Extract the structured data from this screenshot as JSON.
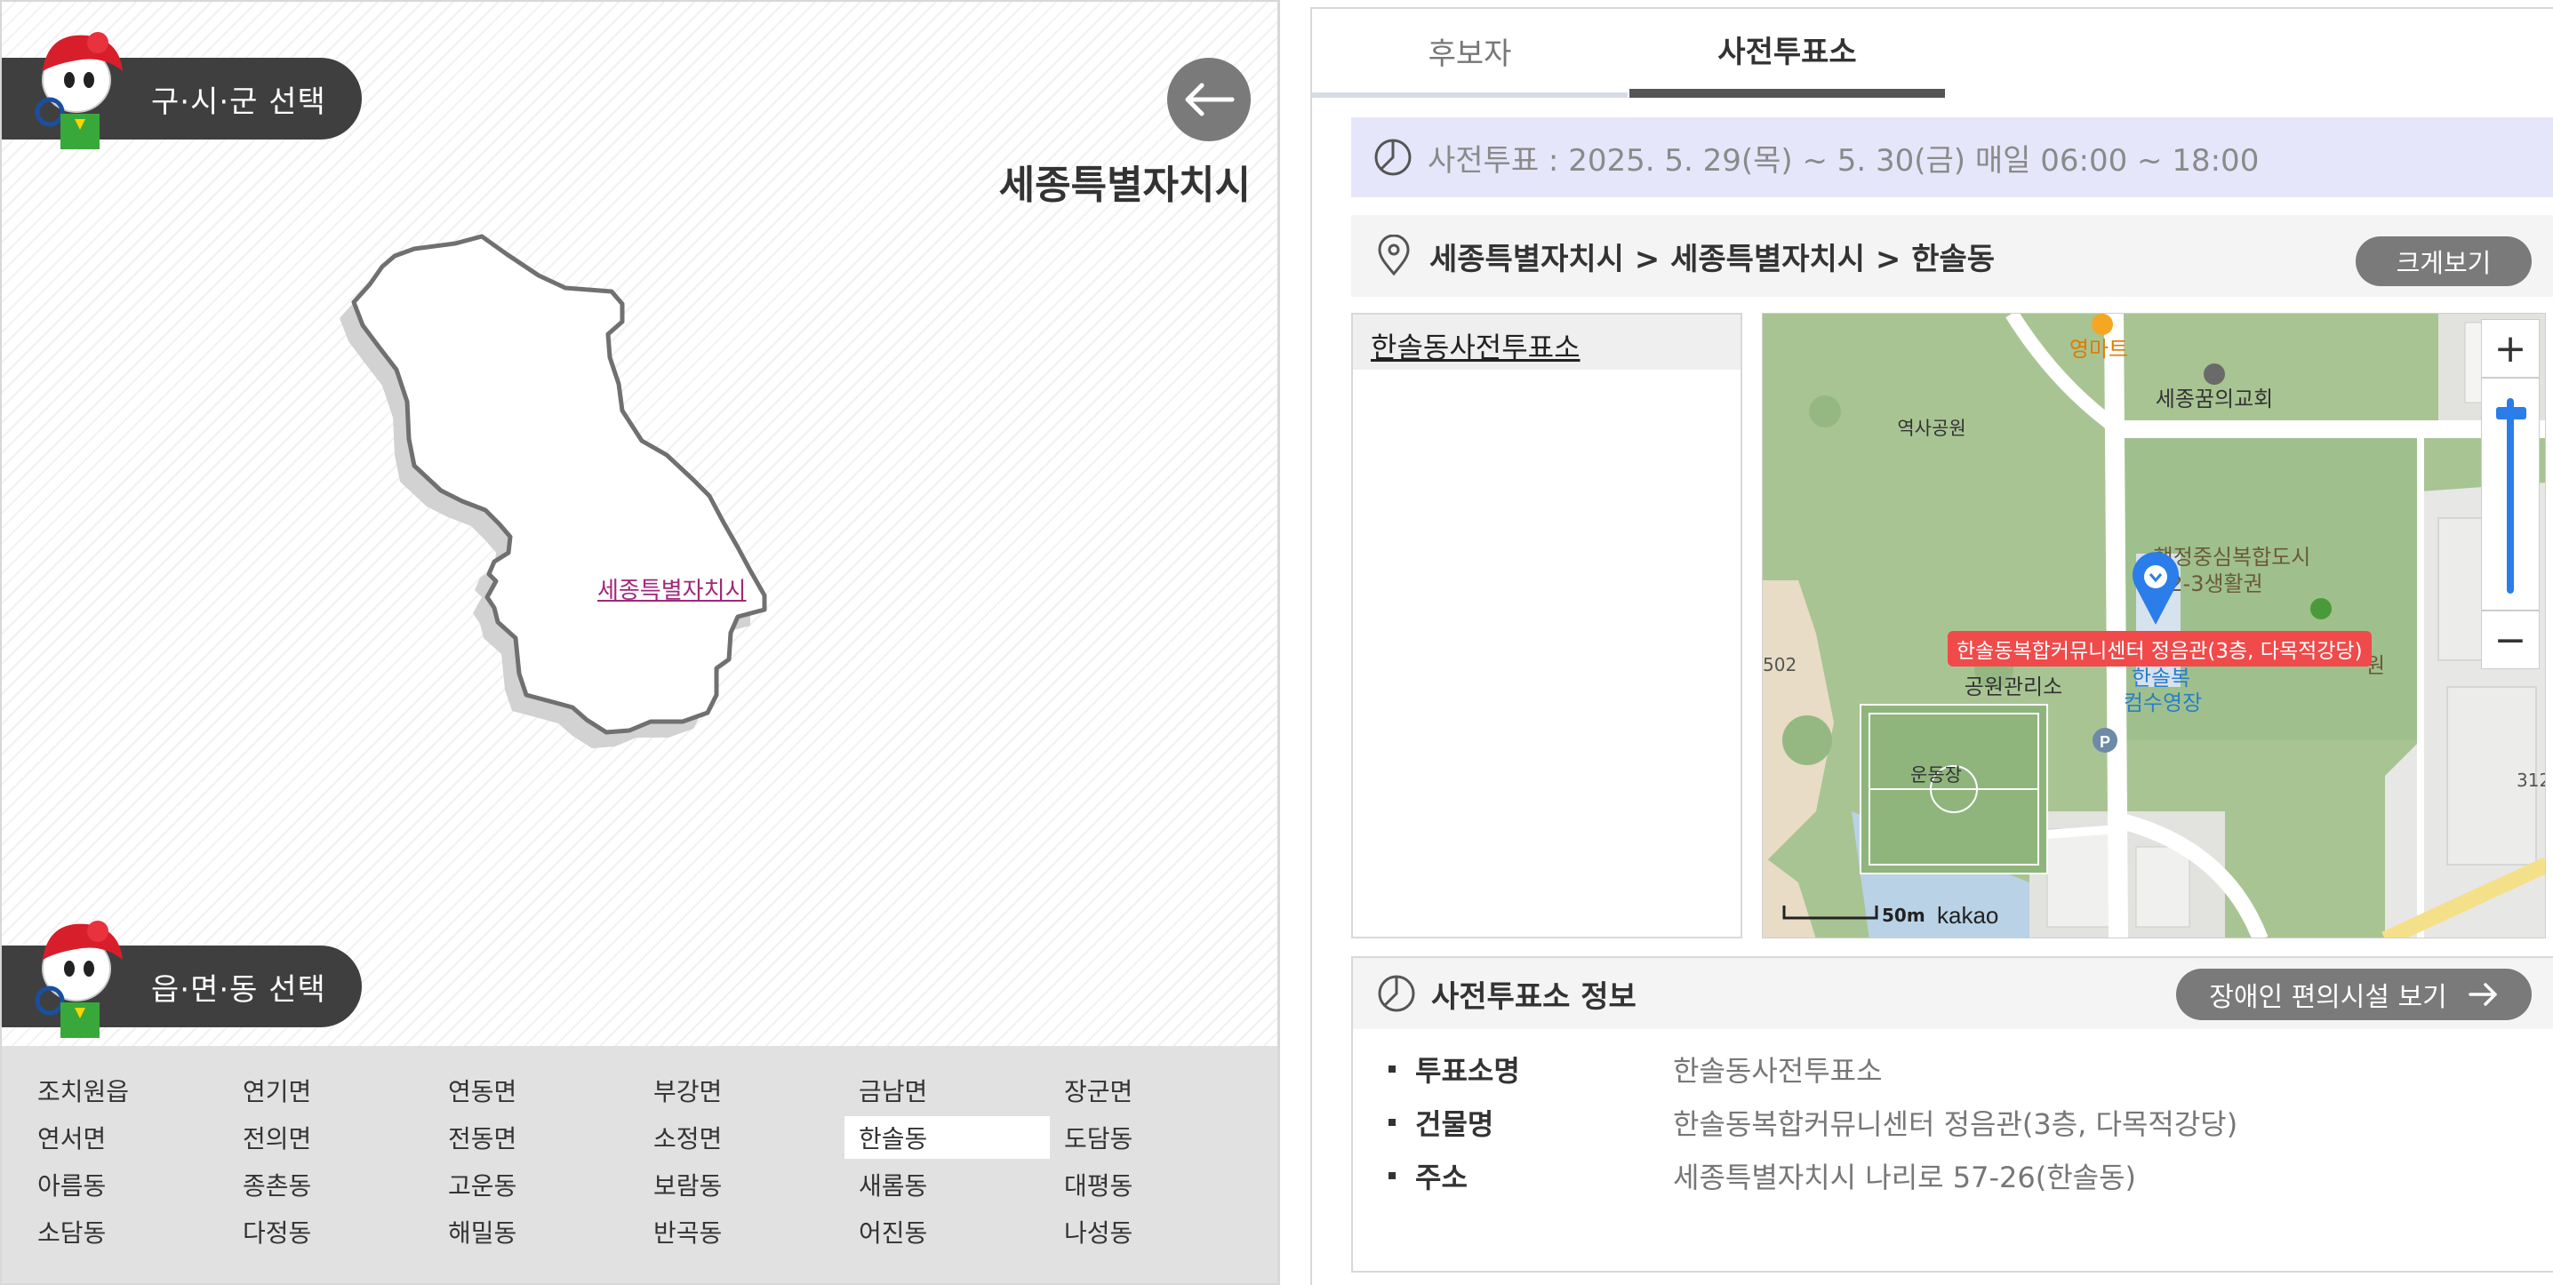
{
  "left": {
    "city_select_label": "구·시·군 선택",
    "district_select_label": "읍·면·동 선택",
    "region_title": "세종특별자치시",
    "map_label": "세종특별자치시",
    "districts": [
      [
        "조치원읍",
        "연기면",
        "연동면",
        "부강면",
        "금남면",
        "장군면"
      ],
      [
        "연서면",
        "전의면",
        "전동면",
        "소정면",
        "한솔동",
        "도담동"
      ],
      [
        "아름동",
        "종촌동",
        "고운동",
        "보람동",
        "새롬동",
        "대평동"
      ],
      [
        "소담동",
        "다정동",
        "해밀동",
        "반곡동",
        "어진동",
        "나성동"
      ]
    ],
    "selected_district": "한솔동"
  },
  "right": {
    "tabs": [
      "후보자",
      "사전투표소"
    ],
    "active_tab": "사전투표소",
    "period_text": "사전투표 : 2025. 5. 29(목) ~ 5. 30(금) 매일 06:00 ~ 18:00",
    "breadcrumb": "세종특별자치시 > 세종특별자치시 > 한솔동",
    "enlarge_label": "크게보기",
    "stations": [
      "한솔동사전투표소"
    ],
    "map": {
      "labels": {
        "mart": "영마트",
        "church": "세종꿈의교회",
        "history_park": "역사공원",
        "complex": "행정중심복합도시",
        "complex2": "2-3생활권",
        "park_office": "공원관리소",
        "pool1": "한솔복",
        "pool2": "컴수영장",
        "stadium": "운동장",
        "num_left": "502",
        "num_right": "312",
        "right_edge": "원",
        "scale": "50m",
        "brand": "kakao",
        "parking": "P"
      },
      "marker_label": "한솔동복합커뮤니센터 정음관(3층, 다목적강당)",
      "zoom_in": "+",
      "zoom_out": "−",
      "zoom_level": 0.1
    },
    "info": {
      "title": "사전투표소 정보",
      "accessibility_label": "장애인 편의시설 보기",
      "rows": [
        {
          "key": "투표소명",
          "value": "한솔동사전투표소"
        },
        {
          "key": "건물명",
          "value": "한솔동복합커뮤니센터 정음관(3층, 다목적강당)"
        },
        {
          "key": "주소",
          "value": "세종특별자치시 나리로 57-26(한솔동)"
        }
      ]
    }
  },
  "colors": {
    "pill_bg": "#3f3f3f",
    "map_outline": "#6e6e6e",
    "map_label": "#a0287a",
    "marker": "#2b7de9",
    "marker_label_bg": "#f04a4a",
    "period_bg": "#e6e6fa"
  }
}
